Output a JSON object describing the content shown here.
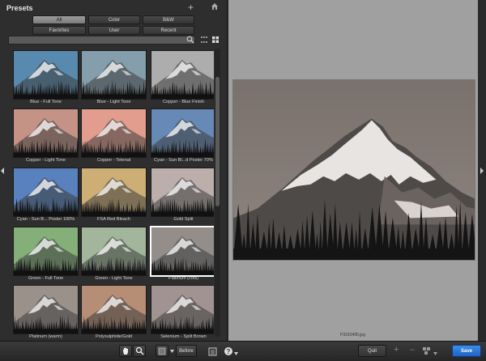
{
  "panel": {
    "title": "Presets",
    "add_glyph": "+",
    "search_placeholder": ""
  },
  "categories": [
    "All",
    "Color",
    "B&W",
    "Favorites",
    "User",
    "Recent"
  ],
  "active_category": "All",
  "presets": [
    {
      "label": "Blue - Full Tone",
      "tint": "#4a7fa8"
    },
    {
      "label": "Blue - Light Tone",
      "tint": "#7a96a4"
    },
    {
      "label": "Copper - Blue Finish",
      "tint": "#a7a6a8"
    },
    {
      "label": "Copper - Light Tone",
      "tint": "#c08a7c"
    },
    {
      "label": "Copper - Tetenal",
      "tint": "#e09585"
    },
    {
      "label": "Cyan - Sun Bl...d Poster  70%",
      "tint": "#5a7fb0"
    },
    {
      "label": "Cyan - Sun B... Poster 100%",
      "tint": "#4a77b8"
    },
    {
      "label": "FSA Red Bleach",
      "tint": "#c9a96a"
    },
    {
      "label": "Gold Split",
      "tint": "#b6a8a4"
    },
    {
      "label": "Green - Full Tone",
      "tint": "#7aa96e"
    },
    {
      "label": "Green - Light Tone",
      "tint": "#9ab092"
    },
    {
      "label": "Platinum (cool)",
      "tint": "#8a8580",
      "selected": true
    },
    {
      "label": "Platinum (warm)",
      "tint": "#928880"
    },
    {
      "label": "Polysulphide/Gold",
      "tint": "#b0856a"
    },
    {
      "label": "Selenium - Split Brown",
      "tint": "#9a8a88"
    }
  ],
  "canvas": {
    "filename": "P3310495.jpg",
    "background": "#a0a0a0"
  },
  "toolbar": {
    "before": "Before",
    "quit": "Quit",
    "save": "Save",
    "plus_glyph": "+",
    "minus_glyph": "–"
  }
}
